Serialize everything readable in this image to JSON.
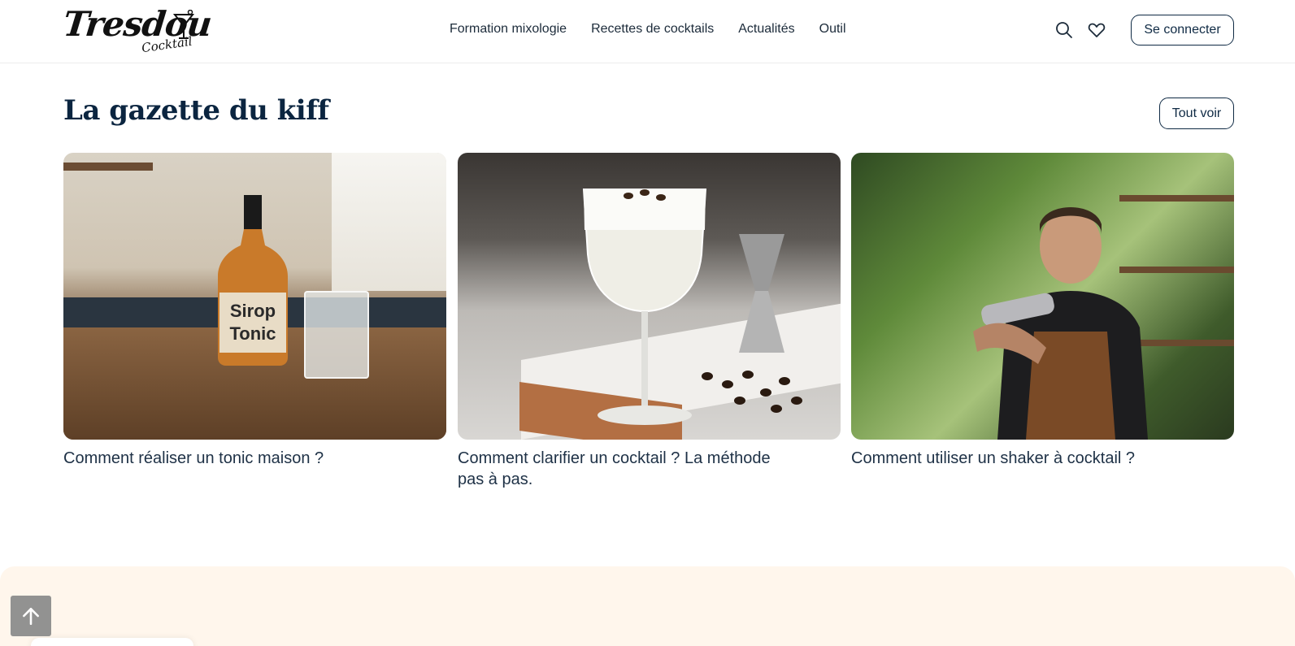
{
  "header": {
    "logo_text": "Tresdou",
    "logo_subtext": "Cocktail",
    "nav": [
      {
        "label": "Formation mixologie"
      },
      {
        "label": "Recettes de cocktails"
      },
      {
        "label": "Actualités"
      },
      {
        "label": "Outil"
      }
    ],
    "icons": {
      "search": "search-icon",
      "favorites": "heart-icon"
    },
    "login_label": "Se connecter"
  },
  "section": {
    "title": "La gazette du kiff",
    "see_all_label": "Tout voir",
    "cards": [
      {
        "title": "Comment réaliser un tonic maison ?",
        "image_label_line1": "Sirop",
        "image_label_line2": "Tonic"
      },
      {
        "title": "Comment clarifier un cocktail ? La méthode pas à pas."
      },
      {
        "title": "Comment utiliser un shaker à cocktail ?"
      }
    ]
  },
  "scroll_top": {
    "icon": "arrow-up-icon"
  },
  "colors": {
    "brand_navy": "#0f2a44",
    "band_cream": "#fff6ec",
    "scroll_gray": "#8d8d8d"
  }
}
